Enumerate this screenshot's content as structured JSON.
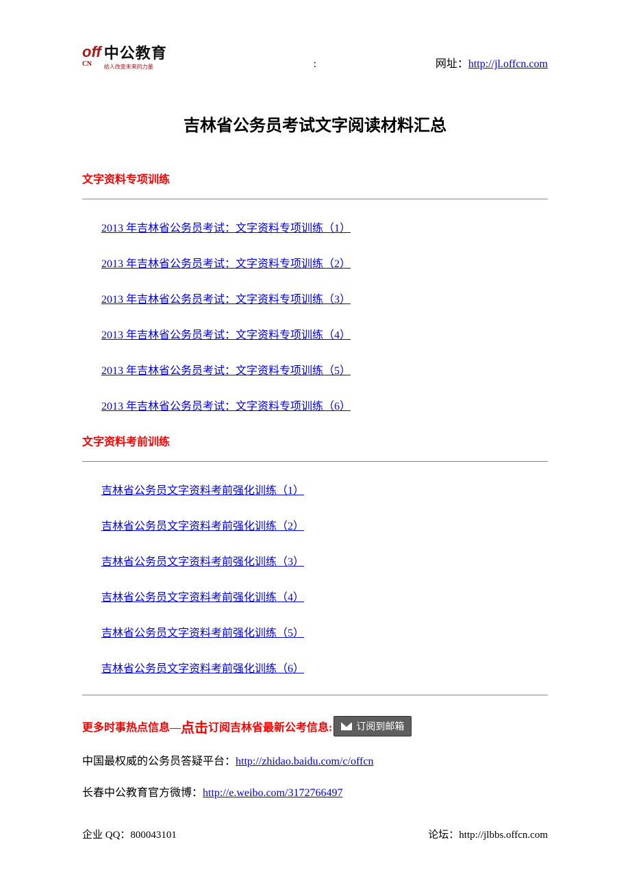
{
  "header": {
    "logo_off": "off",
    "logo_cn": "CN",
    "logo_name": "中公教育",
    "logo_tagline": "给人改变未来的力量",
    "colon": ":",
    "url_label": "网址：",
    "url": "http://jl.offcn.com"
  },
  "title": "吉林省公务员考试文字阅读材料汇总",
  "section1": {
    "heading": "文字资料专项训练",
    "links": [
      "2013 年吉林省公务员考试：文字资料专项训练（1）",
      "2013 年吉林省公务员考试：文字资料专项训练（2）",
      "2013 年吉林省公务员考试：文字资料专项训练（3）",
      "2013 年吉林省公务员考试：文字资料专项训练（4）",
      "2013 年吉林省公务员考试：文字资料专项训练（5）",
      "2013 年吉林省公务员考试：文字资料专项训练（6）"
    ]
  },
  "section2": {
    "heading": "文字资料考前训练",
    "links": [
      "吉林省公务员文字资料考前强化训练（1）",
      "吉林省公务员文字资料考前强化训练（2）",
      "吉林省公务员文字资料考前强化训练（3）",
      "吉林省公务员文字资料考前强化训练（4）",
      "吉林省公务员文字资料考前强化训练（5）",
      "吉林省公务员文字资料考前强化训练（6）"
    ]
  },
  "promo": {
    "prefix": "更多时事热点信息—",
    "big": "点击",
    "suffix": "订阅吉林省最新公考信息:",
    "button": "订阅到邮箱"
  },
  "info1_label": "中国最权威的公务员答疑平台：",
  "info1_url": "http://zhidao.baidu.com/c/offcn",
  "info2_label": "长春中公教育官方微博：",
  "info2_url": "http://e.weibo.com/3172766497",
  "footer": {
    "qq_label": "企业 QQ：",
    "qq_value": "800043101",
    "forum_label": "论坛：",
    "forum_url": "http://jlbbs.offcn.com"
  }
}
